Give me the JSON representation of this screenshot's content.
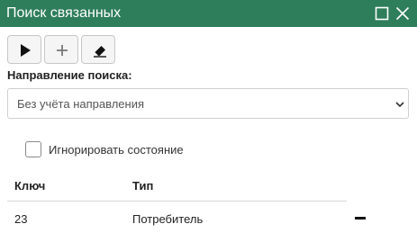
{
  "window": {
    "title": "Поиск связанных",
    "maximize_icon": "maximize-icon",
    "close_icon": "close-icon",
    "title_bar_color": "#2e7d5b"
  },
  "toolbar": {
    "buttons": [
      {
        "icon": "play-icon"
      },
      {
        "icon": "plus-icon"
      },
      {
        "icon": "eraser-icon"
      }
    ]
  },
  "search_direction": {
    "label": "Направление поиска:",
    "selected": "Без учёта направления",
    "chevron_icon": "chevron-down-icon"
  },
  "ignore_state": {
    "label": "Игнорировать состояние",
    "checked": false
  },
  "table": {
    "columns": [
      "Ключ",
      "Тип"
    ],
    "rows": [
      {
        "key": "23",
        "type": "Потребитель",
        "action_icon": "minus-icon"
      }
    ]
  }
}
